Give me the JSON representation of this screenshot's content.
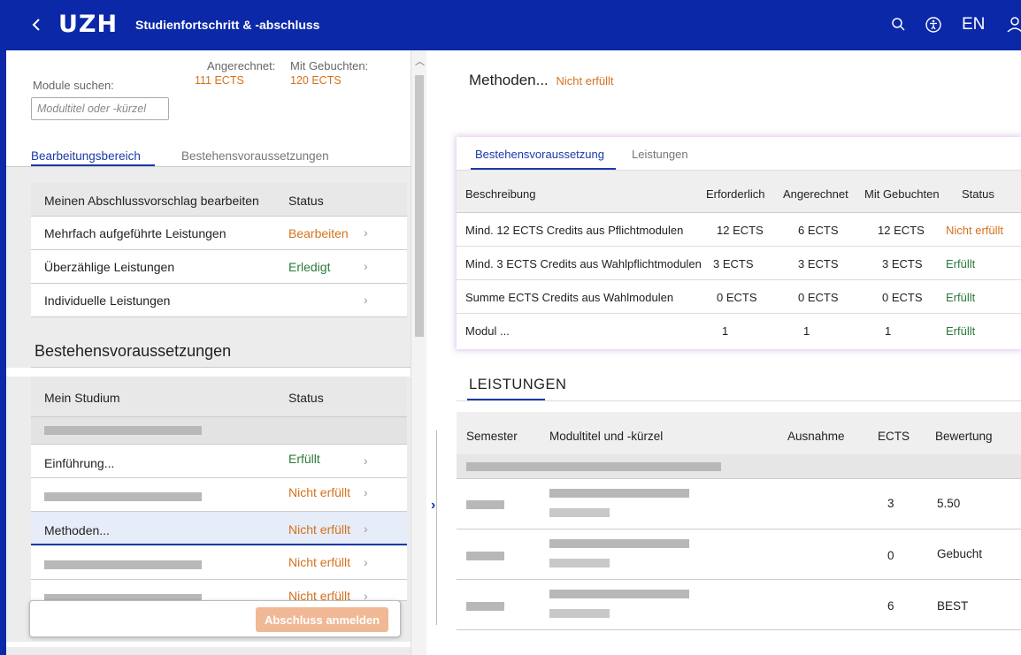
{
  "header": {
    "logo": "UZH",
    "title": "Studienfortschritt & -abschluss",
    "language": "EN"
  },
  "left": {
    "search": {
      "label": "Module suchen:",
      "placeholder": "Modultitel oder -kürzel"
    },
    "credited": {
      "label": "Angerechnet:",
      "value": "111 ECTS"
    },
    "booked": {
      "label": "Mit Gebuchten:",
      "value": "120 ECTS"
    },
    "tabs": [
      "Bearbeitungsbereich",
      "Bestehensvoraussetzungen"
    ],
    "edit_table": {
      "header": {
        "label": "Meinen Abschlussvorschlag bearbeiten",
        "status": "Status"
      },
      "rows": [
        {
          "label": "Mehrfach aufgeführte Leistungen",
          "status": "Bearbeiten"
        },
        {
          "label": "Überzählige Leistungen",
          "status": "Erledigt"
        },
        {
          "label": "Individuelle Leistungen",
          "status": ""
        }
      ]
    },
    "requirements_title": "Bestehensvoraussetzungen",
    "study_table": {
      "header": {
        "label": "Mein Studium",
        "status": "Status"
      },
      "rows": [
        {
          "label": "Einführung...",
          "status": "Erfüllt"
        },
        {
          "label": "",
          "status": "Nicht erfüllt"
        },
        {
          "label": "Methoden...",
          "status": "Nicht erfüllt"
        },
        {
          "label": "",
          "status": "Nicht erfüllt"
        },
        {
          "label": "",
          "status": "Nicht erfüllt"
        }
      ]
    },
    "submit_label": "Abschluss anmelden"
  },
  "right": {
    "title": "Methoden...",
    "title_status": "Nicht erfüllt",
    "tabs": [
      "Bestehensvoraussetzung",
      "Leistungen"
    ],
    "req_table": {
      "columns": [
        "Beschreibung",
        "Erforderlich",
        "Angerechnet",
        "Mit Gebuchten",
        "Status"
      ],
      "rows": [
        [
          "Mind. 12 ECTS Credits aus Pflichtmodulen",
          "12 ECTS",
          "6 ECTS",
          "12 ECTS",
          "Nicht erfüllt"
        ],
        [
          "Mind. 3 ECTS Credits aus Wahlpflichtmodulen",
          "3 ECTS",
          "3 ECTS",
          "3 ECTS",
          "Erfüllt"
        ],
        [
          "Summe ECTS Credits aus Wahlmodulen",
          "0 ECTS",
          "0 ECTS",
          "0 ECTS",
          "Erfüllt"
        ],
        [
          "Modul ...",
          "1",
          "1",
          "1",
          "Erfüllt"
        ]
      ]
    },
    "leistungen_title": "LEISTUNGEN",
    "leistungen_table": {
      "columns": [
        "Semester",
        "Modultitel und -kürzel",
        "Ausnahme",
        "ECTS",
        "Bewertung"
      ],
      "rows": [
        {
          "ects": "3",
          "grade": "5.50"
        },
        {
          "ects": "0",
          "grade": "Gebucht"
        },
        {
          "ects": "6",
          "grade": "BEST"
        }
      ]
    }
  },
  "colors": {
    "brand": "#0a28a8",
    "accent": "#1a3aa8",
    "warning": "#d4721c",
    "success": "#2a7a3a",
    "submit_disabled": "#f0b895"
  },
  "icons": [
    "back-chevron-icon",
    "search-icon",
    "accessibility-icon",
    "user-icon",
    "chevron-right-icon",
    "chevron-up-icon"
  ]
}
